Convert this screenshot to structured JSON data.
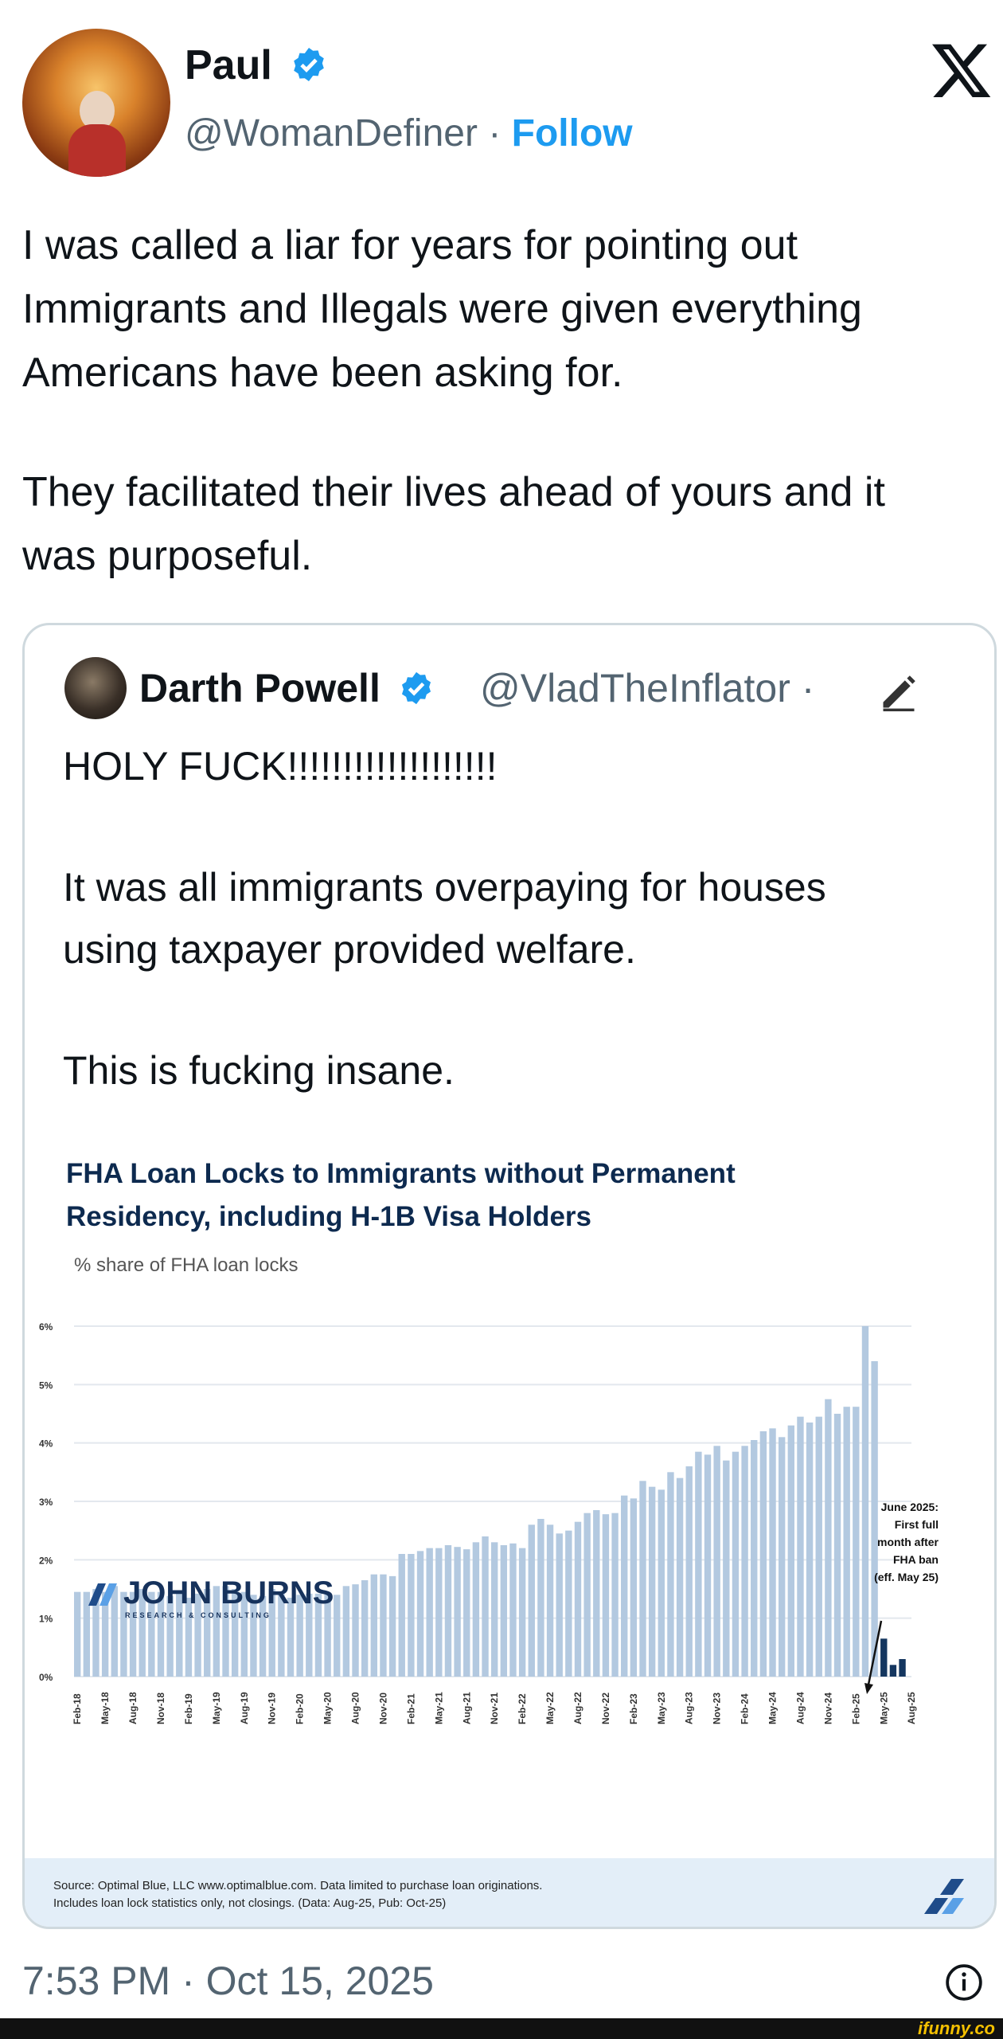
{
  "tweet": {
    "author_name": "Paul",
    "handle": "@WomanDefiner",
    "separator": "·",
    "follow_label": "Follow",
    "text_line_1": "I was called a liar for years for pointing out",
    "text_line_2": "Immigrants and Illegals were given everything",
    "text_line_3": "Americans have been asking for.",
    "text_line_4": "They facilitated their lives ahead of yours and it",
    "text_line_5": "was purposeful.",
    "timestamp": "7:53 PM · Oct 15, 2025"
  },
  "quote": {
    "author_name": "Darth Powell",
    "handle": "@VladTheInflator ·",
    "line_1": "HOLY FUCK!!!!!!!!!!!!!!!!!!!",
    "line_2": "It was all immigrants overpaying for houses",
    "line_3": "using taxpayer provided welfare.",
    "line_4": "This is fucking insane."
  },
  "chart_data": {
    "type": "bar",
    "title": "FHA Loan Locks to Immigrants without Permanent Residency, including H-1B Visa Holders",
    "title_line_1": "FHA Loan Locks to Immigrants without Permanent",
    "title_line_2": "Residency, including H-1B Visa Holders",
    "subtitle": "% share of FHA loan locks",
    "ylim": [
      0,
      6
    ],
    "y_ticks": [
      "0%",
      "1%",
      "2%",
      "3%",
      "4%",
      "5%",
      "6%"
    ],
    "x_tick_labels": [
      "Feb-18",
      "May-18",
      "Aug-18",
      "Nov-18",
      "Feb-19",
      "May-19",
      "Aug-19",
      "Nov-19",
      "Feb-20",
      "May-20",
      "Aug-20",
      "Nov-20",
      "Feb-21",
      "May-21",
      "Aug-21",
      "Nov-21",
      "Feb-22",
      "May-22",
      "Aug-22",
      "Nov-22",
      "Feb-23",
      "May-23",
      "Aug-23",
      "Nov-23",
      "Feb-24",
      "May-24",
      "Aug-24",
      "Nov-24",
      "Feb-25",
      "May-25",
      "Aug-25"
    ],
    "values": [
      1.45,
      1.45,
      1.5,
      1.45,
      1.55,
      1.45,
      1.45,
      1.5,
      1.45,
      1.45,
      1.38,
      1.45,
      1.35,
      1.42,
      1.5,
      1.55,
      1.55,
      1.5,
      1.45,
      1.4,
      1.38,
      1.5,
      1.45,
      1.35,
      1.4,
      1.42,
      1.42,
      1.42,
      1.4,
      1.55,
      1.58,
      1.65,
      1.75,
      1.75,
      1.72,
      2.1,
      2.1,
      2.15,
      2.2,
      2.2,
      2.25,
      2.22,
      2.18,
      2.3,
      2.4,
      2.3,
      2.25,
      2.28,
      2.2,
      2.6,
      2.7,
      2.6,
      2.45,
      2.5,
      2.65,
      2.8,
      2.85,
      2.78,
      2.8,
      3.1,
      3.05,
      3.35,
      3.25,
      3.2,
      3.5,
      3.4,
      3.6,
      3.85,
      3.8,
      3.95,
      3.7,
      3.85,
      3.95,
      4.05,
      4.2,
      4.25,
      4.1,
      4.3,
      4.45,
      4.35,
      4.45,
      4.75,
      4.5,
      4.62,
      4.62,
      6.0,
      5.4,
      0.65,
      0.2,
      0.3
    ],
    "highlight_from_index": 87,
    "colors": {
      "bar": "#b3c9e0",
      "highlight": "#14365f",
      "grid": "#e3e8ee"
    },
    "annotation": [
      "June 2025:",
      "First full",
      "month after",
      "FHA ban",
      "(eff. May 25)"
    ],
    "logo_text": "JOHN BURNS",
    "logo_subtext": "RESEARCH & CONSULTING",
    "source_line_1": "Source: Optimal Blue, LLC www.optimalblue.com. Data limited to purchase loan originations.",
    "source_line_2": "Includes loan lock statistics only, not closings. (Data: Aug-25, Pub: Oct-25)"
  },
  "footer": {
    "watermark": "ifunny.co"
  },
  "icons": {
    "verified": "verified-badge-icon",
    "x_logo": "x-logo-icon",
    "edit": "edit-pencil-icon",
    "info": "info-icon"
  }
}
